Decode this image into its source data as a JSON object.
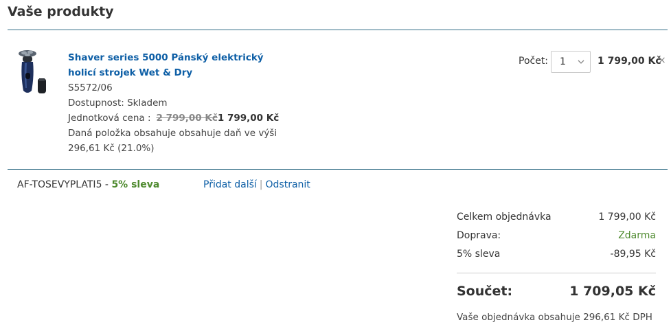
{
  "section": {
    "title": "Vaše produkty"
  },
  "product": {
    "title": "Shaver series 5000 Pánský elektrický holicí strojek Wet & Dry",
    "sku": "S5572/06",
    "availability": "Dostupnost: Skladem",
    "unit_price_label": "Jednotková cena :",
    "old_price": "2 799,00 Kč",
    "new_price": "1 799,00 Kč",
    "tax_note": "Daná položka obsahuje obsahuje daň ve výši 296,61 Kč (21.0%)",
    "image_icon": "electric-shaver-image",
    "quantity_label": "Počet:",
    "quantity_value": "1",
    "line_total": "1 799,00 Kč",
    "remove_symbol": "×"
  },
  "coupon": {
    "code": "AF-TOSEVYPLATI5",
    "separator": " - ",
    "discount": "5% sleva",
    "add_more": "Přidat další",
    "divider": "|",
    "remove": "Odstranit"
  },
  "summary": {
    "rows": [
      {
        "label": "Celkem objednávka",
        "value": "1 799,00 Kč"
      },
      {
        "label": "Doprava:",
        "value": "Zdarma"
      },
      {
        "label": "5% sleva",
        "value": "-89,95 Kč"
      }
    ],
    "total_label": "Součet:",
    "total_value": "1 709,05 Kč",
    "vat_note": "Vaše objednávka obsahuje 296,61 Kč DPH"
  },
  "colors": {
    "link": "#0e5fa6",
    "rule": "#2e6b84",
    "success": "#4e8a2e"
  }
}
